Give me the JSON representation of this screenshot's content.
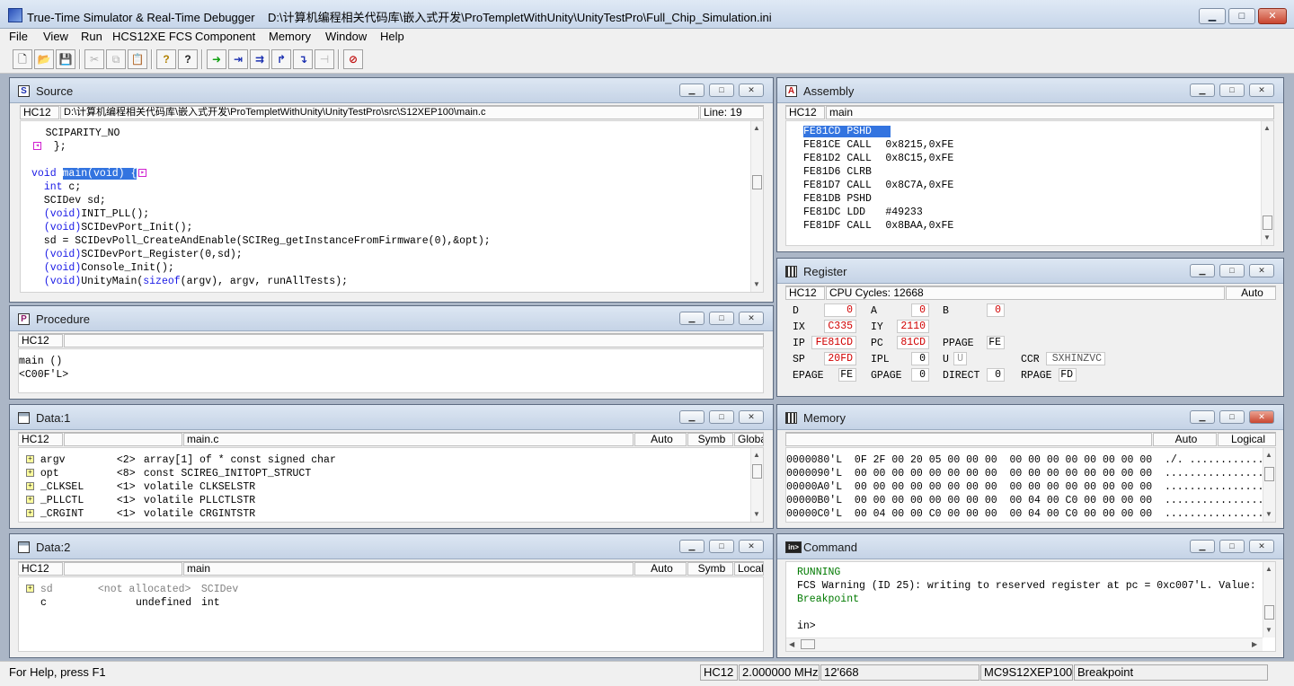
{
  "window": {
    "title": "True-Time Simulator & Real-Time Debugger",
    "path": "D:\\计算机编程相关代码库\\嵌入式开发\\ProTempletWithUnity\\UnityTestPro\\Full_Chip_Simulation.ini",
    "min": "▁",
    "max": "□",
    "close": "✕"
  },
  "menu": [
    "File",
    "View",
    "Run",
    "HCS12XE FCS",
    "Component",
    "Memory",
    "Window",
    "Help"
  ],
  "toolbar": {
    "new": "🗋",
    "open": "📂",
    "save": "💾",
    "cut": "✂",
    "copy": "⧉",
    "paste": "📋",
    "help": "?",
    "context_help": "?",
    "start": "➜",
    "single_step": "⇥",
    "step_over": "⇉",
    "step_out": "↱",
    "assembly_step": "↴",
    "halt": "⊣",
    "reset": "⊘"
  },
  "source": {
    "title": "Source",
    "icon": "S",
    "target": "HC12",
    "file": "D:\\计算机编程相关代码库\\嵌入式开发\\ProTempletWithUnity\\UnityTestPro\\src\\S12XEP100\\main.c",
    "line_label": "Line: 19",
    "lines": [
      {
        "t": "    SCIPARITY_NO"
      },
      {
        "t": "  };"
      },
      {
        "t": ""
      },
      {
        "t": "main(void)"
      },
      {
        "t": "  int c;"
      },
      {
        "t": "  SCIDev sd;"
      },
      {
        "t": "  (void)INIT_PLL();"
      },
      {
        "t": "  (void)SCIDevPort_Init();"
      },
      {
        "t": "  sd = SCIDevPoll_CreateAndEnable(SCIReg_getInstanceFromFirmware(0),&opt);"
      },
      {
        "t": "  (void)SCIDevPort_Register(0,sd);"
      },
      {
        "t": "  (void)Console_Init();"
      },
      {
        "t": "  (void)UnityMain(sizeof(argv), argv, runAllTests);"
      }
    ],
    "kw_void": "void",
    "kw_int": "int",
    "sizeof": "sizeof",
    "brace": "{"
  },
  "procedure": {
    "title": "Procedure",
    "icon": "P",
    "target": "HC12",
    "lines": [
      "main ()",
      "<C00F'L>"
    ]
  },
  "data1": {
    "title": "Data:1",
    "target": "HC12",
    "module": "main.c",
    "mode": "Auto",
    "format": "Symb",
    "scope": "Global",
    "rows": [
      {
        "name": "argv",
        "size": "<2>",
        "type": "array[1] of * const signed char"
      },
      {
        "name": "opt",
        "size": "<8>",
        "type": "const SCIREG_INITOPT_STRUCT"
      },
      {
        "name": "_CLKSEL",
        "size": "<1>",
        "type": "volatile CLKSELSTR"
      },
      {
        "name": "_PLLCTL",
        "size": "<1>",
        "type": "volatile PLLCTLSTR"
      },
      {
        "name": "_CRGINT",
        "size": "<1>",
        "type": "volatile CRGINTSTR"
      }
    ]
  },
  "data2": {
    "title": "Data:2",
    "target": "HC12",
    "module": "main",
    "mode": "Auto",
    "format": "Symb",
    "scope": "Local",
    "rows": [
      {
        "name": "sd",
        "size": "<not allocated>",
        "type": "SCIDev"
      },
      {
        "name": "c",
        "size": "undefined",
        "type": "int"
      }
    ]
  },
  "assembly": {
    "title": "Assembly",
    "icon": "A",
    "target": "HC12",
    "proc": "main",
    "rows": [
      {
        "addr": "FE81CD",
        "op": "PSHD",
        "arg": ""
      },
      {
        "addr": "FE81CE",
        "op": "CALL",
        "arg": "0x8215,0xFE"
      },
      {
        "addr": "FE81D2",
        "op": "CALL",
        "arg": "0x8C15,0xFE"
      },
      {
        "addr": "FE81D6",
        "op": "CLRB",
        "arg": ""
      },
      {
        "addr": "FE81D7",
        "op": "CALL",
        "arg": "0x8C7A,0xFE"
      },
      {
        "addr": "FE81DB",
        "op": "PSHD",
        "arg": ""
      },
      {
        "addr": "FE81DC",
        "op": "LDD",
        "arg": "#49233"
      },
      {
        "addr": "FE81DF",
        "op": "CALL",
        "arg": "0x8BAA,0xFE"
      }
    ]
  },
  "register": {
    "title": "Register",
    "target": "HC12",
    "cycles": "CPU Cycles:  12668",
    "mode": "Auto",
    "D": "0",
    "A": "0",
    "B": "0",
    "IX": "C335",
    "IY": "2110",
    "IP": "FE81CD",
    "PC": "81CD",
    "PPAGE": "FE",
    "SP": "20FD",
    "IPL": "0",
    "U": "U",
    "CCR": "SXHINZVC",
    "EPAGE": "FE",
    "GPAGE": "0",
    "DIRECT": "0",
    "RPAGE": "FD",
    "labels": {
      "D": "D",
      "A": "A",
      "B": "B",
      "IX": "IX",
      "IY": "IY",
      "IP": "IP",
      "PC": "PC",
      "PPAGE": "PPAGE",
      "SP": "SP",
      "IPL": "IPL",
      "U": "U",
      "CCR": "CCR",
      "EPAGE": "EPAGE",
      "GPAGE": "GPAGE",
      "DIRECT": "DIRECT",
      "RPAGE": "RPAGE"
    }
  },
  "memory": {
    "title": "Memory",
    "mode": "Auto",
    "format": "Logical",
    "rows": [
      "0000080'L  0F 2F 00 20 05 00 00 00  00 00 00 00 00 00 00 00  ./. ............",
      "0000090'L  00 00 00 00 00 00 00 00  00 00 00 00 00 00 00 00  ................",
      "00000A0'L  00 00 00 00 00 00 00 00  00 00 00 00 00 00 00 00  ................",
      "00000B0'L  00 00 00 00 00 00 00 00  00 04 00 C0 00 00 00 00  ................",
      "00000C0'L  00 04 00 00 C0 00 00 00  00 04 00 C0 00 00 00 00  ................"
    ]
  },
  "command": {
    "title": "Command",
    "icon": "in>",
    "lines": [
      {
        "t": "RUNNING",
        "c": "green"
      },
      {
        "t": "FCS Warning (ID 25): writing to reserved register at pc = 0xc007'L. Value:",
        "c": ""
      },
      {
        "t": "Breakpoint",
        "c": "green"
      },
      {
        "t": "",
        "c": ""
      },
      {
        "t": "in>",
        "c": ""
      }
    ]
  },
  "status": {
    "help": "For Help, press F1",
    "cpu": "HC12",
    "freq": "2.000000 MHz",
    "cycles": "12'668",
    "chip": "MC9S12XEP100",
    "state": "Breakpoint"
  }
}
